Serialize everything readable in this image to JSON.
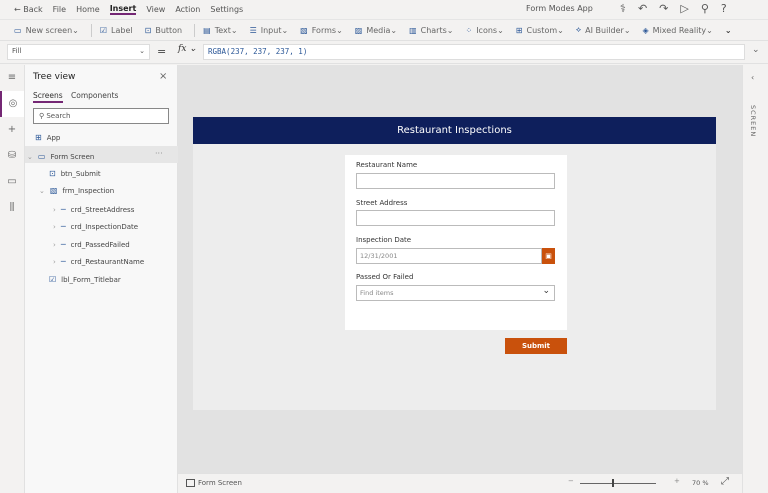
{
  "menu": {
    "back": "Back",
    "items": [
      "File",
      "Home",
      "Insert",
      "View",
      "Action",
      "Settings"
    ],
    "active": "Insert",
    "app_name": "Form Modes App"
  },
  "toolbar": {
    "items": [
      {
        "label": "New screen",
        "icon": "new-screen-icon",
        "dropdown": true
      },
      {
        "label": "Label",
        "icon": "label-icon",
        "dropdown": false
      },
      {
        "label": "Button",
        "icon": "button-icon",
        "dropdown": false
      },
      {
        "label": "Text",
        "icon": "text-icon",
        "dropdown": true
      },
      {
        "label": "Input",
        "icon": "input-icon",
        "dropdown": true
      },
      {
        "label": "Forms",
        "icon": "forms-icon",
        "dropdown": true
      },
      {
        "label": "Media",
        "icon": "media-icon",
        "dropdown": true
      },
      {
        "label": "Charts",
        "icon": "charts-icon",
        "dropdown": true
      },
      {
        "label": "Icons",
        "icon": "icons-icon",
        "dropdown": true
      },
      {
        "label": "Custom",
        "icon": "custom-icon",
        "dropdown": true
      },
      {
        "label": "AI Builder",
        "icon": "ai-builder-icon",
        "dropdown": true
      },
      {
        "label": "Mixed Reality",
        "icon": "mixed-reality-icon",
        "dropdown": true
      }
    ]
  },
  "formula": {
    "property": "Fill",
    "fx": "fx",
    "value": "RGBA(237, 237, 237, 1)"
  },
  "tree": {
    "title": "Tree view",
    "tabs": [
      "Screens",
      "Components"
    ],
    "search_placeholder": "Search",
    "items": [
      {
        "label": "App",
        "icon": "app-icon"
      },
      {
        "label": "Form Screen",
        "icon": "screen-icon"
      },
      {
        "label": "btn_Submit",
        "icon": "button-icon"
      },
      {
        "label": "frm_Inspection",
        "icon": "form-icon"
      },
      {
        "label": "crd_StreetAddress",
        "icon": "card-icon"
      },
      {
        "label": "crd_InspectionDate",
        "icon": "card-icon"
      },
      {
        "label": "crd_PassedFailed",
        "icon": "card-icon"
      },
      {
        "label": "crd_RestaurantName",
        "icon": "card-icon"
      },
      {
        "label": "lbl_Form_Titlebar",
        "icon": "label-icon"
      }
    ]
  },
  "app": {
    "title": "Restaurant Inspections",
    "fields": [
      {
        "label": "Restaurant Name",
        "value": ""
      },
      {
        "label": "Street Address",
        "value": ""
      },
      {
        "label": "Inspection Date",
        "value": "12/31/2001"
      },
      {
        "label": "Passed Or Failed",
        "placeholder": "Find items"
      }
    ],
    "submit": "Submit"
  },
  "right_pane": {
    "label": "SCREEN"
  },
  "status": {
    "screen": "Form Screen",
    "zoom": "70 %"
  },
  "colors": {
    "titlebar": "#0e1f5c",
    "accent": "#c9510c",
    "brand": "#742774"
  }
}
